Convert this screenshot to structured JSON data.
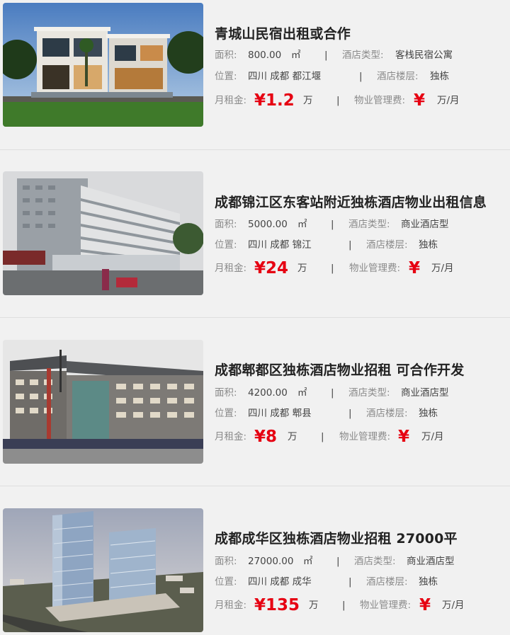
{
  "labels": {
    "area": "面积:",
    "hotel_type": "酒店类型:",
    "location": "位置:",
    "floors": "酒店楼层:",
    "rent": "月租金:",
    "mgmt_fee": "物业管理费:",
    "area_unit": "㎡",
    "rent_unit": "万",
    "currency": "¥",
    "fee_unit": "万/月",
    "separator": "|"
  },
  "listings": [
    {
      "title": "青城山民宿出租或合作",
      "area": "800.00",
      "hotel_type": "客栈民宿公寓",
      "location": "四川 成都 都江堰",
      "floors": "独栋",
      "rent": "¥1.2",
      "image_icon": "villa-photo"
    },
    {
      "title": "成都锦江区东客站附近独栋酒店物业出租信息",
      "area": "5000.00",
      "hotel_type": "商业酒店型",
      "location": "四川 成都 锦江",
      "floors": "独栋",
      "rent": "¥24",
      "image_icon": "hotel-building-photo"
    },
    {
      "title": "成都郫都区独栋酒店物业招租 可合作开发",
      "area": "4200.00",
      "hotel_type": "商业酒店型",
      "location": "四川 成都 郫县",
      "floors": "独栋",
      "rent": "¥8",
      "image_icon": "street-hotel-photo"
    },
    {
      "title": "成都成华区独栋酒店物业招租 27000平",
      "area": "27000.00",
      "hotel_type": "商业酒店型",
      "location": "四川 成都 成华",
      "floors": "独栋",
      "rent": "¥135",
      "image_icon": "highrise-rendering-photo"
    }
  ]
}
